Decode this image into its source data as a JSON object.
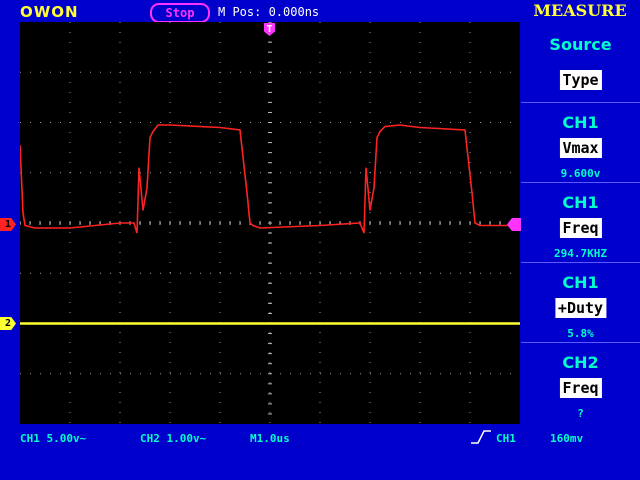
{
  "header": {
    "brand": "OWON",
    "run_status": "Stop",
    "m_pos": "M Pos: 0.000ns",
    "measure_title": "MEASURE"
  },
  "markers": {
    "trigger_top": "T",
    "ch1": "1",
    "ch2": "2"
  },
  "measure_panel": [
    {
      "heading": "Source",
      "button": "Type",
      "value": ""
    },
    {
      "heading": "CH1",
      "button": "Vmax",
      "value": "9.600v"
    },
    {
      "heading": "CH1",
      "button": "Freq",
      "value": "294.7KHZ"
    },
    {
      "heading": "CH1",
      "button": "+Duty",
      "value": "5.8%"
    },
    {
      "heading": "CH2",
      "button": "Freq",
      "value": "?"
    }
  ],
  "bottom_bar": {
    "ch1_scale": "CH1 5.00v~",
    "ch2_scale": "CH2 1.00v~",
    "timebase": "M1.0us",
    "trigger_source": "CH1",
    "trigger_level": "160mv"
  },
  "colors": {
    "background": "#0000cc",
    "screen": "#000000",
    "ch1": "#ff2222",
    "ch2": "#ffff33",
    "trigger": "#ff33ff",
    "text_accent": "#00ffcc"
  },
  "chart_data": {
    "type": "line",
    "title": "",
    "xlabel": "",
    "ylabel": "",
    "grid": true,
    "grid_divisions": {
      "x": 10,
      "y": 8
    },
    "x_units": "div",
    "y_units": "div",
    "xlim": [
      0,
      10
    ],
    "ylim": [
      -4,
      4
    ],
    "series": [
      {
        "name": "CH1",
        "color": "#ff2222",
        "x": [
          0,
          0.06,
          0.1,
          0.3,
          1.0,
          2.0,
          2.28,
          2.34,
          2.38,
          2.46,
          2.54,
          2.6,
          2.66,
          2.76,
          3.0,
          4.0,
          4.4,
          4.54,
          4.6,
          4.66,
          4.8,
          6.0,
          6.8,
          6.88,
          6.92,
          7.0,
          7.08,
          7.14,
          7.2,
          7.3,
          7.6,
          8.0,
          8.9,
          9.04,
          9.1,
          9.2,
          9.6,
          10.0
        ],
        "y": [
          1.55,
          0.2,
          -0.05,
          -0.1,
          -0.1,
          0.0,
          0.0,
          -0.2,
          1.1,
          0.25,
          0.7,
          1.7,
          1.82,
          1.95,
          1.95,
          1.9,
          1.85,
          0.6,
          0.0,
          -0.05,
          -0.1,
          -0.05,
          0.0,
          -0.2,
          1.1,
          0.25,
          0.7,
          1.7,
          1.82,
          1.92,
          1.95,
          1.9,
          1.85,
          0.6,
          0.0,
          -0.05,
          -0.05,
          -0.05
        ]
      },
      {
        "name": "CH2",
        "color": "#ffff33",
        "x": [
          0,
          10
        ],
        "y": [
          -2.0,
          -2.0
        ]
      }
    ],
    "ch1_ground_div": 0,
    "ch2_ground_div": -2.0,
    "trigger_level_div": 0.0
  }
}
